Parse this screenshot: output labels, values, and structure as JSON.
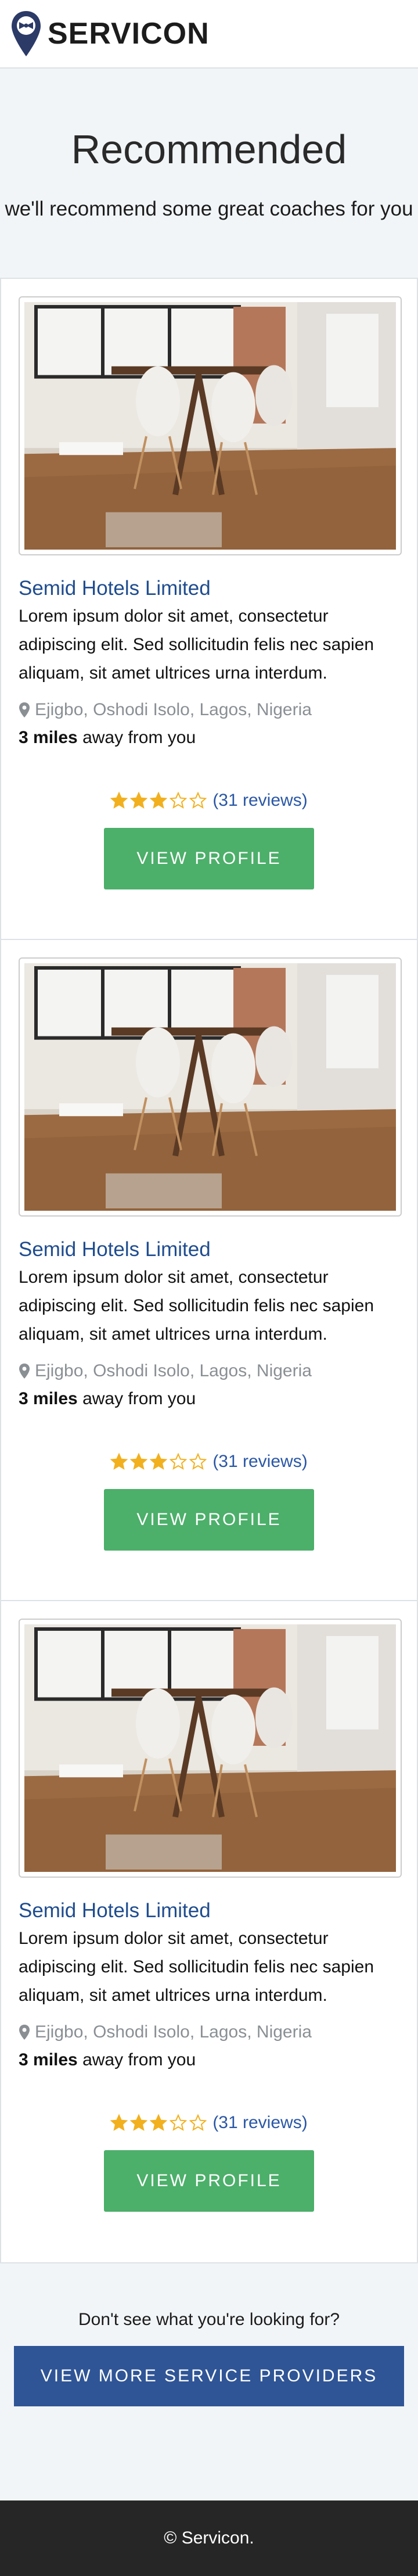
{
  "nav": {
    "brand": "SERVICON"
  },
  "hero": {
    "title": "Recommended",
    "subtitle": "we'll recommend some great coaches for you"
  },
  "cards": [
    {
      "title": "Semid Hotels Limited",
      "description": "Lorem ipsum dolor sit amet, consectetur adipiscing elit. Sed sollicitudin felis nec sapien aliquam, sit amet ultrices urna interdum.",
      "location": "Ejigbo, Oshodi Isolo, Lagos, Nigeria",
      "distance": "3 miles",
      "distance_suffix": " away from you",
      "rating": 3,
      "rating_max": 5,
      "reviews": "(31 reviews)",
      "button": "VIEW PROFILE"
    },
    {
      "title": "Semid Hotels Limited",
      "description": "Lorem ipsum dolor sit amet, consectetur adipiscing elit. Sed sollicitudin felis nec sapien aliquam, sit amet ultrices urna interdum.",
      "location": "Ejigbo, Oshodi Isolo, Lagos, Nigeria",
      "distance": "3 miles",
      "distance_suffix": " away from you",
      "rating": 3,
      "rating_max": 5,
      "reviews": "(31 reviews)",
      "button": "VIEW PROFILE"
    },
    {
      "title": "Semid Hotels Limited",
      "description": "Lorem ipsum dolor sit amet, consectetur adipiscing elit. Sed sollicitudin felis nec sapien aliquam, sit amet ultrices urna interdum.",
      "location": "Ejigbo, Oshodi Isolo, Lagos, Nigeria",
      "distance": "3 miles",
      "distance_suffix": " away from you",
      "rating": 3,
      "rating_max": 5,
      "reviews": "(31 reviews)",
      "button": "VIEW PROFILE"
    }
  ],
  "more": {
    "prompt": "Don't see what you're looking for?",
    "button": "VIEW MORE SERVICE PROVIDERS"
  },
  "footer": {
    "text": "© Servicon."
  },
  "colors": {
    "brand_blue": "#1f4c8f",
    "button_green": "#4caf6a",
    "button_blue": "#2f5596",
    "star_gold": "#f2b01e",
    "footer_bg": "#262626"
  },
  "icons": {
    "logo": "map-pin-bowtie-icon",
    "location": "map-marker-icon",
    "star_filled": "star-filled-icon",
    "star_empty": "star-outline-icon"
  }
}
